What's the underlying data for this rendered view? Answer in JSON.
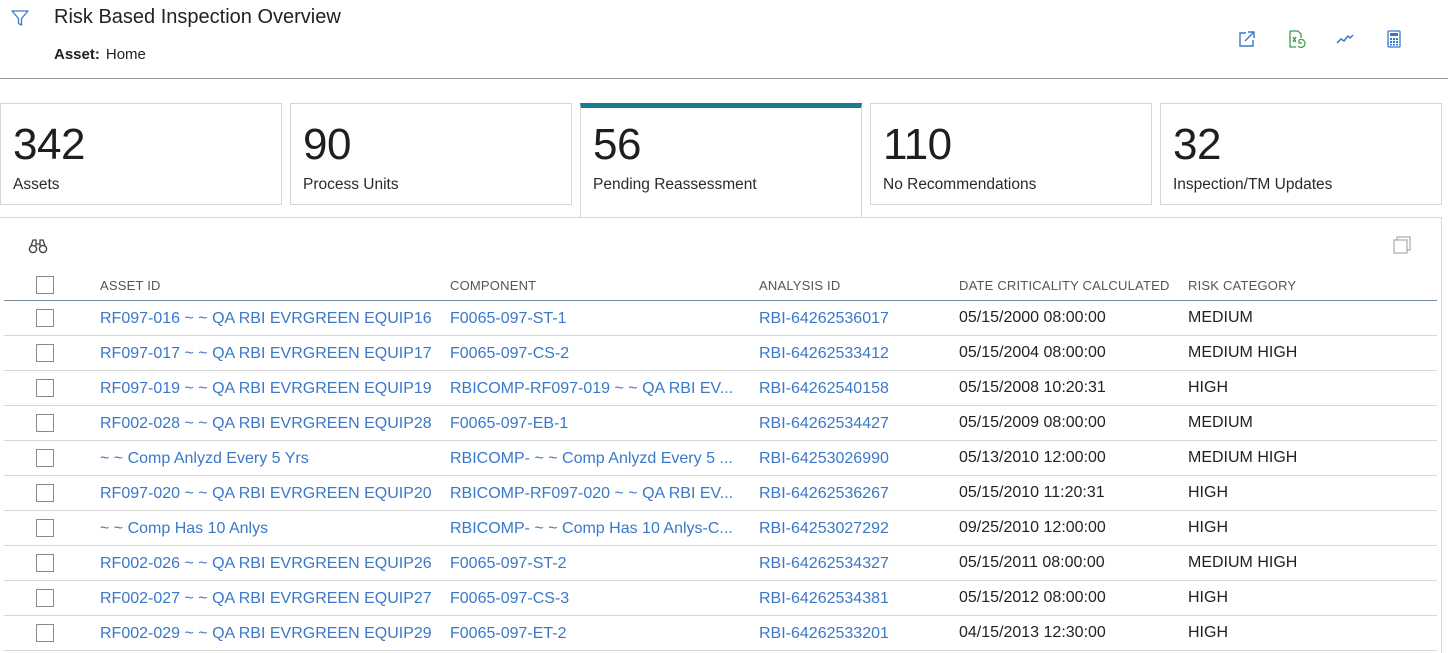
{
  "header": {
    "title": "Risk Based Inspection Overview",
    "asset_label": "Asset:",
    "asset_value": "Home",
    "icons": [
      "filter-icon",
      "open-external-icon",
      "export-icon",
      "trend-icon",
      "calculator-icon"
    ]
  },
  "cards": [
    {
      "count": "342",
      "label": "Assets"
    },
    {
      "count": "90",
      "label": "Process Units"
    },
    {
      "count": "56",
      "label": "Pending Reassessment"
    },
    {
      "count": "110",
      "label": "No Recommendations"
    },
    {
      "count": "32",
      "label": "Inspection/TM Updates"
    }
  ],
  "table": {
    "columns": {
      "asset_id": "ASSET ID",
      "component": "COMPONENT",
      "analysis_id": "ANALYSIS ID",
      "date": "DATE CRITICALITY CALCULATED",
      "risk": "RISK CATEGORY"
    },
    "rows": [
      {
        "asset": "RF097-016 ~ ~ QA RBI EVRGREEN EQUIP16",
        "component": "F0065-097-ST-1",
        "analysis": "RBI-64262536017",
        "date": "05/15/2000 08:00:00",
        "risk": "MEDIUM"
      },
      {
        "asset": "RF097-017 ~ ~ QA RBI EVRGREEN EQUIP17",
        "component": "F0065-097-CS-2",
        "analysis": "RBI-64262533412",
        "date": "05/15/2004 08:00:00",
        "risk": "MEDIUM HIGH"
      },
      {
        "asset": "RF097-019 ~ ~ QA RBI EVRGREEN EQUIP19",
        "component": "RBICOMP-RF097-019 ~ ~ QA RBI EV...",
        "analysis": "RBI-64262540158",
        "date": "05/15/2008 10:20:31",
        "risk": "HIGH"
      },
      {
        "asset": "RF002-028 ~ ~ QA RBI EVRGREEN EQUIP28",
        "component": "F0065-097-EB-1",
        "analysis": "RBI-64262534427",
        "date": "05/15/2009 08:00:00",
        "risk": "MEDIUM"
      },
      {
        "asset": "~ ~ Comp Anlyzd Every 5 Yrs",
        "component": "RBICOMP- ~ ~ Comp Anlyzd Every 5 ...",
        "analysis": "RBI-64253026990",
        "date": "05/13/2010 12:00:00",
        "risk": "MEDIUM HIGH"
      },
      {
        "asset": "RF097-020 ~ ~ QA RBI EVRGREEN EQUIP20",
        "component": "RBICOMP-RF097-020 ~ ~ QA RBI EV...",
        "analysis": "RBI-64262536267",
        "date": "05/15/2010 11:20:31",
        "risk": "HIGH"
      },
      {
        "asset": "~ ~ Comp Has 10 Anlys",
        "component": "RBICOMP- ~ ~ Comp Has 10 Anlys-C...",
        "analysis": "RBI-64253027292",
        "date": "09/25/2010 12:00:00",
        "risk": "HIGH"
      },
      {
        "asset": "RF002-026 ~ ~ QA RBI EVRGREEN EQUIP26",
        "component": "F0065-097-ST-2",
        "analysis": "RBI-64262534327",
        "date": "05/15/2011 08:00:00",
        "risk": "MEDIUM HIGH"
      },
      {
        "asset": "RF002-027 ~ ~ QA RBI EVRGREEN EQUIP27",
        "component": "F0065-097-CS-3",
        "analysis": "RBI-64262534381",
        "date": "05/15/2012 08:00:00",
        "risk": "HIGH"
      },
      {
        "asset": "RF002-029 ~ ~ QA RBI EVRGREEN EQUIP29",
        "component": "F0065-097-ET-2",
        "analysis": "RBI-64262533201",
        "date": "04/15/2013 12:30:00",
        "risk": "HIGH"
      }
    ]
  },
  "colors": {
    "link": "#3a78c9",
    "active_tab": "#1a7c93",
    "icon_blue": "#3a78c9",
    "icon_green": "#3d9a4a"
  }
}
